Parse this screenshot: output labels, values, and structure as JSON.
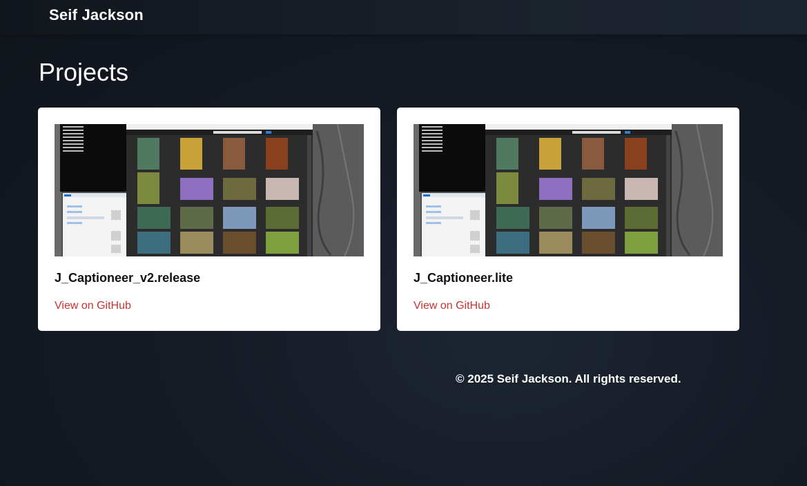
{
  "header": {
    "brand": "Seif Jackson"
  },
  "main": {
    "section_title": "Projects",
    "projects": [
      {
        "title": "J_Captioneer_v2.release",
        "link_label": "View on GitHub"
      },
      {
        "title": "J_Captioneer.lite",
        "link_label": "View on GitHub"
      }
    ]
  },
  "footer": {
    "text": "© 2025 Seif Jackson. All rights reserved."
  },
  "colors": {
    "background": "#151b25",
    "card": "#ffffff",
    "link": "#c8322f"
  }
}
